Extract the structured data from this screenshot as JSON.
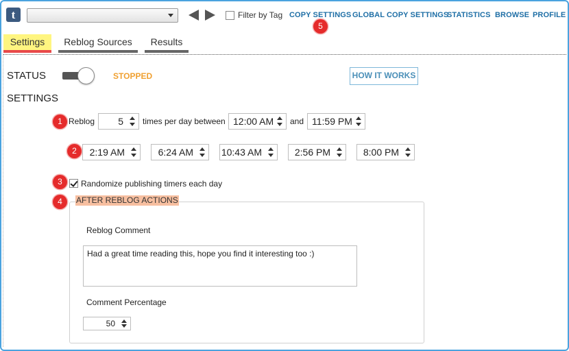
{
  "app": {
    "logo_letter": "t"
  },
  "toolbar": {
    "blog_select_value": "",
    "filter_by_tag_label": "Filter by Tag",
    "filter_by_tag_checked": false,
    "links": [
      "COPY SETTINGS",
      "GLOBAL COPY SETTINGS",
      "STATISTICS",
      "BROWSE",
      "PROFILE"
    ]
  },
  "tabs": [
    {
      "label": "Settings",
      "active": true
    },
    {
      "label": "Reblog Sources",
      "active": false
    },
    {
      "label": "Results",
      "active": false
    }
  ],
  "status": {
    "label": "STATUS",
    "value": "STOPPED",
    "enabled": false,
    "value_color": "#f0a030"
  },
  "how_it_works": "HOW IT WORKS",
  "settings_label": "SETTINGS",
  "reblog": {
    "prefix": "Reblog",
    "count": "5",
    "mid_text": "times per day between",
    "start_time": "12:00 AM",
    "and_text": "and",
    "end_time": "11:59 PM"
  },
  "publish_times": [
    "2:19 AM",
    "6:24 AM",
    "10:43 AM",
    "2:56 PM",
    "8:00 PM"
  ],
  "randomize": {
    "label": "Randomize publishing timers each day",
    "checked": true
  },
  "after_reblog": {
    "title": "AFTER REBLOG ACTIONS",
    "comment_label": "Reblog Comment",
    "comment_value": "Had a great time reading this, hope you find it interesting too :)",
    "percentage_label": "Comment Percentage",
    "percentage_value": "50"
  },
  "badges": [
    "1",
    "2",
    "3",
    "4",
    "5"
  ],
  "colors": {
    "accent_link": "#1f6fa6",
    "badge": "#e52b2b",
    "frame": "#4aa3df",
    "active_tab_highlight": "#fff580",
    "active_tab_underline": "#e8494a",
    "section_highlight": "#f7bfa0"
  }
}
